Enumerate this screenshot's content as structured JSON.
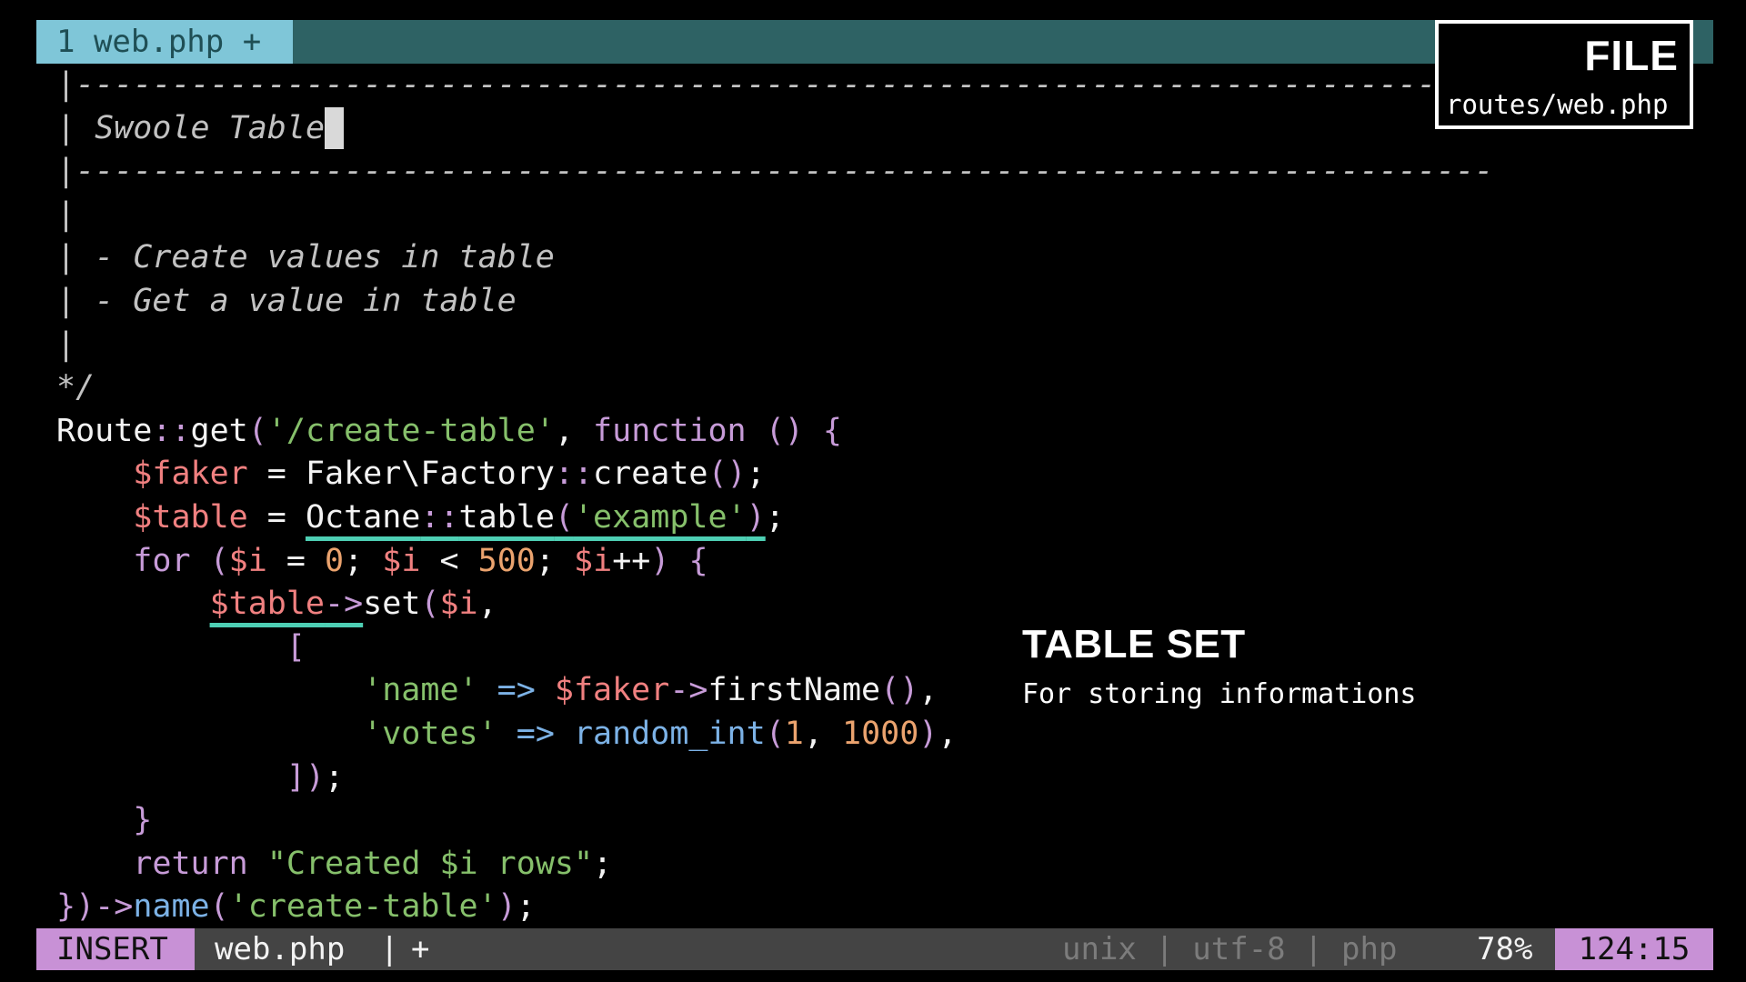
{
  "tabline": {
    "active_tab": "1 web.php +"
  },
  "file_badge": {
    "title": "FILE",
    "path": "routes/web.php"
  },
  "code": {
    "comment_top_border": "|------------------------------------------------------------------------",
    "comment_title_bar": "| ",
    "comment_title": "Swoole Table",
    "comment_bottom_border": "|--------------------------------------------------------------------------",
    "comment_blank_1": "|",
    "comment_item_1": "| - Create values in table",
    "comment_item_2": "| - Get a value in table",
    "comment_blank_2": "|",
    "comment_end": "*/",
    "l10": {
      "route": "Route",
      "dcolon": "::",
      "get": "get",
      "open": "(",
      "path": "'/create-table'",
      "comma": ", ",
      "function": "function",
      "sp": " ",
      "parens": "()",
      "brace": " {"
    },
    "l11": {
      "indent": "    ",
      "var": "$faker",
      "eq": " = ",
      "class": "Faker\\Factory",
      "dcolon": "::",
      "method": "create",
      "parens": "()",
      "semi": ";"
    },
    "l12": {
      "indent": "    ",
      "var": "$table",
      "eq": " = ",
      "class": "Octane",
      "dcolon": "::",
      "method": "table",
      "open": "(",
      "arg": "'example'",
      "close": ")",
      "semi": ";"
    },
    "l13": {
      "indent": "    ",
      "for": "for",
      "sp": " ",
      "open": "(",
      "var1": "$i",
      "eq": " = ",
      "zero": "0",
      "semi1": "; ",
      "var2": "$i",
      "lt": " < ",
      "limit": "500",
      "semi2": "; ",
      "var3": "$i",
      "inc": "++",
      "close": ")",
      "brace": " {"
    },
    "l14": {
      "indent": "        ",
      "var": "$table",
      "arrow": "->",
      "method": "set",
      "open": "(",
      "arg": "$i",
      "comma": ","
    },
    "l15": {
      "indent": "            ",
      "bracket": "["
    },
    "l16": {
      "indent": "                ",
      "key": "'name'",
      "arrow": " => ",
      "var": "$faker",
      "op": "->",
      "method": "firstName",
      "parens": "()",
      "comma": ","
    },
    "l17": {
      "indent": "                ",
      "key": "'votes'",
      "arrow": " => ",
      "func": "random_int",
      "open": "(",
      "min": "1",
      "comma1": ", ",
      "max": "1000",
      "close": ")",
      "comma2": ","
    },
    "l18": {
      "indent": "            ",
      "close": "])",
      "semi": ";"
    },
    "l19": {
      "indent": "    ",
      "brace": "}"
    },
    "l20": {
      "indent": "    ",
      "return": "return",
      "sp": " ",
      "string": "\"Created $i rows\"",
      "semi": ";"
    },
    "l21": {
      "close": "})",
      "arrow": "->",
      "method": "name",
      "open": "(",
      "arg": "'create-table'",
      "close2": ")",
      "semi": ";"
    }
  },
  "annotation": {
    "title": "TABLE SET",
    "subtitle": "For storing informations"
  },
  "statusline": {
    "mode": "INSERT",
    "filename": "web.php",
    "separator": "|",
    "modified": "+",
    "encoding": "unix | utf-8 | php",
    "percent": "78%",
    "position": "124:15"
  },
  "colors": {
    "tabline_bg": "#2e6264",
    "tab_active_bg": "#7fc6d8",
    "mode_bg": "#c891d6",
    "keyword": "#c79bd8",
    "string": "#86c06b",
    "variable": "#f08080",
    "number": "#eba36e",
    "function": "#7cb2e6",
    "underline": "#4ecfb4"
  }
}
